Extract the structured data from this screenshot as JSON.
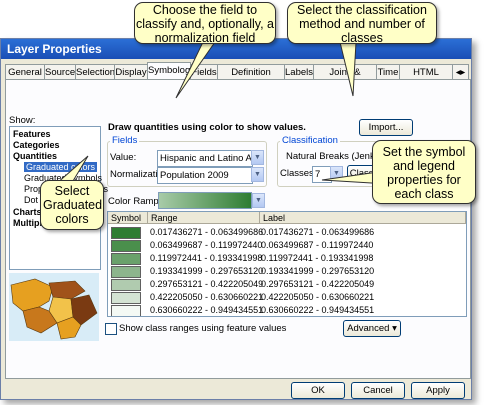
{
  "dialog": {
    "title": "Layer Properties"
  },
  "tabs": [
    "General",
    "Source",
    "Selection",
    "Display",
    "Symbology",
    "Fields",
    "Definition Query",
    "Labels",
    "Joins & Relates",
    "Time",
    "HTML Popup"
  ],
  "active_tab": "Symbology",
  "show": {
    "label": "Show:",
    "items": [
      "Features",
      "Categories",
      "Quantities",
      "Graduated colors",
      "Graduated symbols",
      "Proportional symbols",
      "Dot density",
      "Charts",
      "Multiple Attributes"
    ],
    "selected": "Graduated colors"
  },
  "heading": "Draw quantities using color to show values.",
  "import_label": "Import...",
  "fields": {
    "group_label": "Fields",
    "value_label": "Value:",
    "value": "Hispanic and Latino Americ",
    "normalization_label": "Normalization:",
    "normalization": "Population 2009"
  },
  "classification": {
    "group_label": "Classification",
    "method": "Natural Breaks (Jenks)",
    "classes_label": "Classes:",
    "classes": "7",
    "classify_label": "Classify..."
  },
  "color_ramp_label": "Color Ramp:",
  "grid": {
    "headers": [
      "Symbol",
      "Range",
      "Label"
    ],
    "rows": [
      {
        "color": "#2e7d32",
        "range": "0.017436271 - 0.063499686",
        "label": "0.017436271 - 0.063499686"
      },
      {
        "color": "#4a8f4c",
        "range": "0.063499687 - 0.119972440",
        "label": "0.063499687 - 0.119972440"
      },
      {
        "color": "#6aa16b",
        "range": "0.119972441 - 0.193341998",
        "label": "0.119972441 - 0.193341998"
      },
      {
        "color": "#8db58d",
        "range": "0.193341999 - 0.297653120",
        "label": "0.193341999 - 0.297653120"
      },
      {
        "color": "#b0cbaf",
        "range": "0.297653121 - 0.422205049",
        "label": "0.297653121 - 0.422205049"
      },
      {
        "color": "#d4e3d3",
        "range": "0.422205050 - 0.630660221",
        "label": "0.422205050 - 0.630660221"
      },
      {
        "color": "#f4f9f4",
        "range": "0.630660222 - 0.949434551",
        "label": "0.630660222 - 0.949434551"
      }
    ]
  },
  "show_ranges_label": "Show class ranges using feature values",
  "advanced_label": "Advanced",
  "buttons": {
    "ok": "OK",
    "cancel": "Cancel",
    "apply": "Apply"
  },
  "callouts": {
    "field": "Choose the field to classify and, optionally, a normalization field",
    "classification": "Select the classification method and number of classes",
    "symbol": "Set the symbol and legend properties for each class",
    "graduated": "Select Graduated colors"
  },
  "colors": {
    "ramp_start": "#a8cba8",
    "ramp_end": "#2e7d32",
    "callout_fill": "#ffffc7",
    "selection": "#316ac5"
  }
}
